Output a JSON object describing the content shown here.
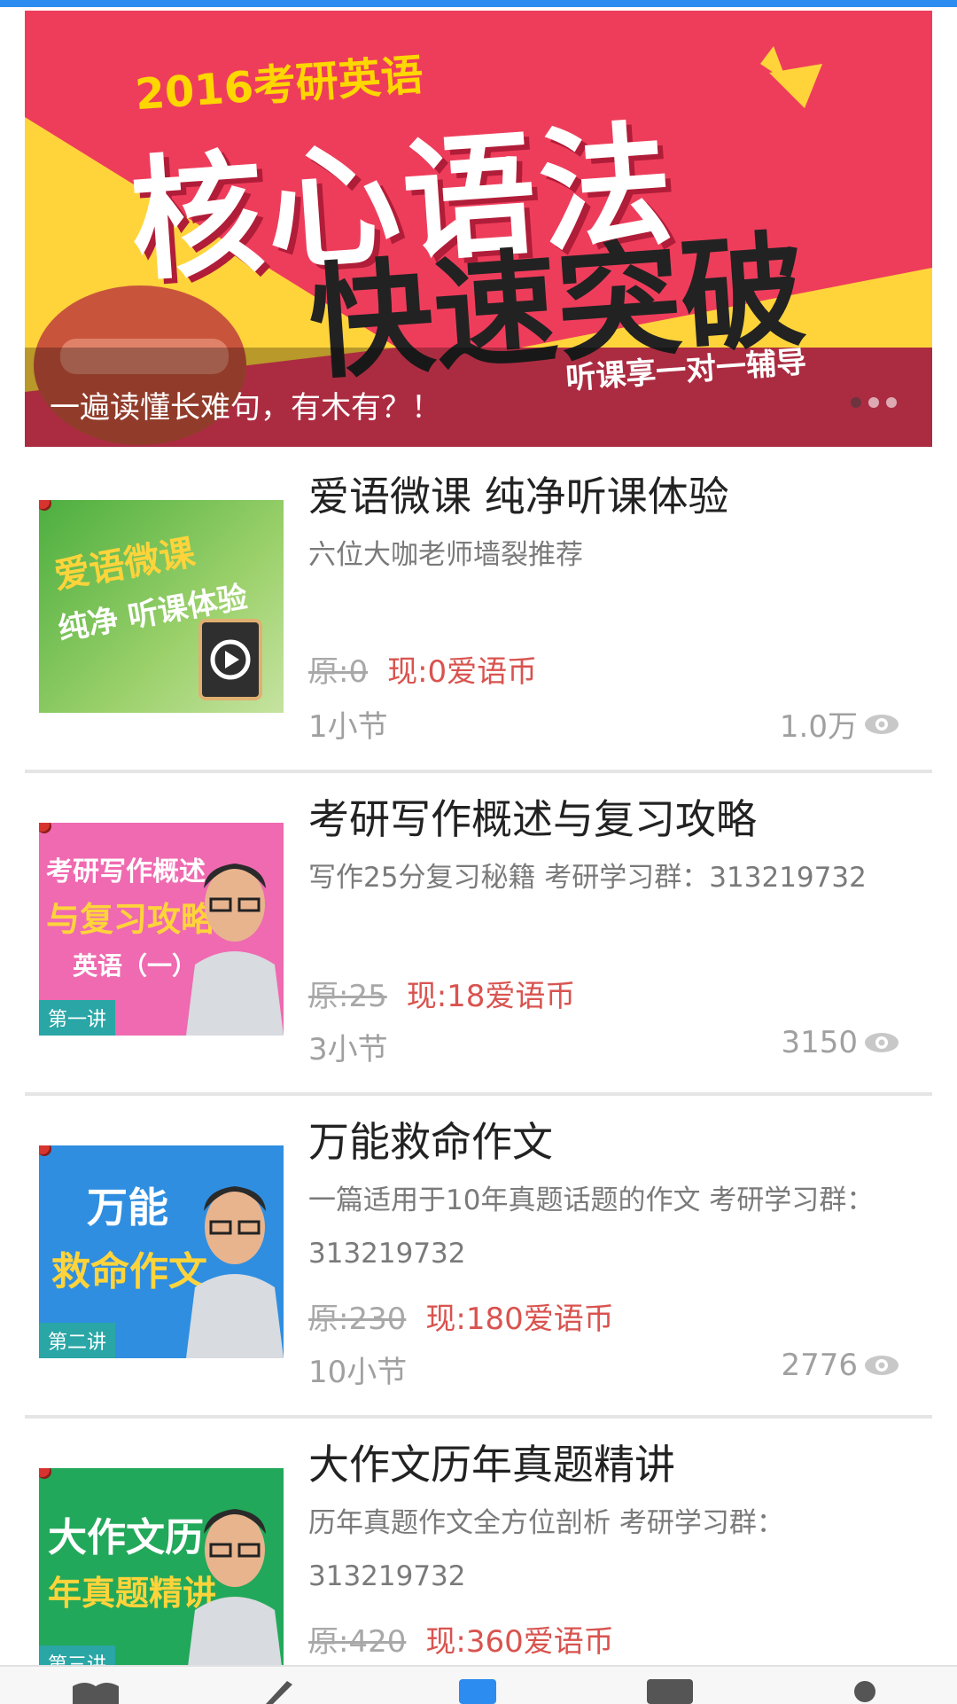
{
  "banner": {
    "year_text": "2016考研英语",
    "title_line1": "核心语法",
    "title_line2": "快速突破",
    "tagline": "听课享一对一辅导",
    "caption": "一遍读懂长难句，有木有？！"
  },
  "courses": [
    {
      "title": "爱语微课 纯净听课体验",
      "desc": "六位大咖老师墙裂推荐",
      "orig_price": "原:0",
      "now_price": "现:0爱语币",
      "sections": "1小节",
      "views": "1.0万",
      "thumb": {
        "line1": "爱语微课",
        "line2": "纯净 听课体验"
      }
    },
    {
      "title": "考研写作概述与复习攻略",
      "desc": "写作25分复习秘籍 考研学习群：313219732",
      "orig_price": "原:25",
      "now_price": "现:18爱语币",
      "sections": "3小节",
      "views": "3150",
      "thumb": {
        "line1": "考研写作概述",
        "line2": "与复习攻略",
        "line3": "英语（一）",
        "tag": "第一讲"
      }
    },
    {
      "title": "万能救命作文",
      "desc": "一篇适用于10年真题话题的作文 考研学习群：313219732",
      "orig_price": "原:230",
      "now_price": "现:180爱语币",
      "sections": "10小节",
      "views": "2776",
      "thumb": {
        "line1": "万能",
        "line2": "救命作文",
        "tag": "第二讲"
      }
    },
    {
      "title": "大作文历年真题精讲",
      "desc": "历年真题作文全方位剖析 考研学习群：313219732",
      "orig_price": "原:420",
      "now_price": "现:360爱语币",
      "thumb": {
        "line1": "大作文历",
        "line2": "年真题精讲",
        "tag": "第三讲"
      }
    }
  ],
  "colors": {
    "accent_blue": "#2c8cf0",
    "price_red": "#d9534f",
    "banner_red": "#ee3d5b",
    "banner_yellow": "#ffd43b"
  }
}
